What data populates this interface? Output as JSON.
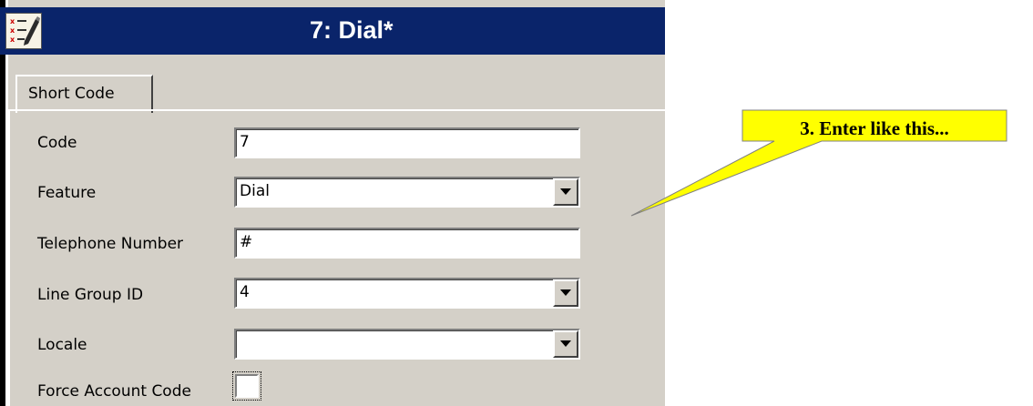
{
  "window": {
    "title": "7: Dial*",
    "icon": "edit-list-icon"
  },
  "tabs": [
    {
      "label": "Short Code",
      "active": true
    }
  ],
  "form": {
    "code": {
      "label": "Code",
      "value": "7"
    },
    "feature": {
      "label": "Feature",
      "value": "Dial"
    },
    "telephone_number": {
      "label": "Telephone Number",
      "value": "#"
    },
    "line_group_id": {
      "label": "Line Group ID",
      "value": "4"
    },
    "locale": {
      "label": "Locale",
      "value": ""
    },
    "force_account_code": {
      "label": "Force Account Code",
      "checked": false
    }
  },
  "callout": {
    "text": "3. Enter like this...",
    "fill_color": "#ffff00"
  },
  "colors": {
    "titlebar": "#0a246a",
    "window_bg": "#d4d0c8"
  }
}
